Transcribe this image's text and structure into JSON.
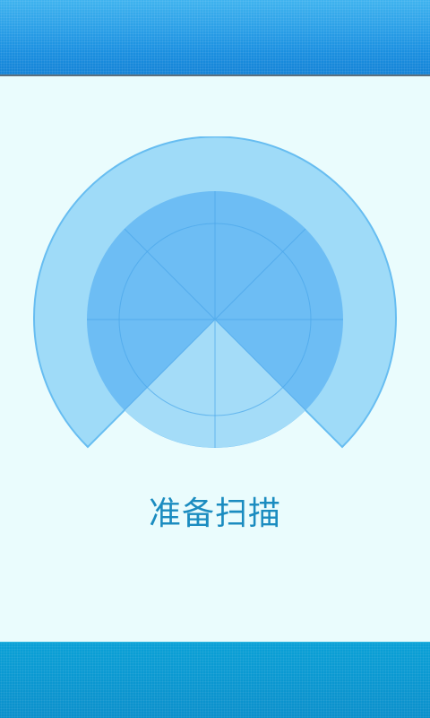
{
  "scan": {
    "status_label": "准备扫描",
    "colors": {
      "outer_ring": "#9fdbf8",
      "outer_ring_stroke": "#67bdf1",
      "inner_disc": "#6dbdf4",
      "sweep_sector": "#a4dcf8",
      "grid_lines": "#4aa6ea",
      "status_text": "#1b8cc0"
    }
  },
  "header": {
    "color": "#1a8fe0"
  },
  "footer": {
    "color": "#0b8fcb"
  }
}
